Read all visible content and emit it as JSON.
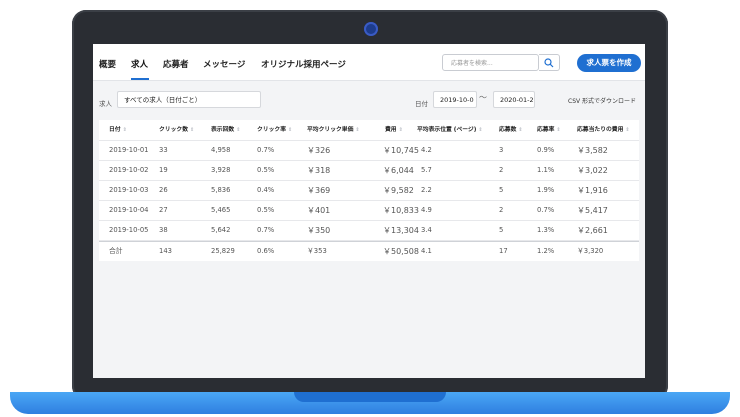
{
  "nav": {
    "tabs": [
      {
        "label": "概要"
      },
      {
        "label": "求人"
      },
      {
        "label": "応募者"
      },
      {
        "label": "メッセージ"
      },
      {
        "label": "オリジナル採用ページ"
      }
    ],
    "active_tab": "求人",
    "search_placeholder": "応募者を検索...",
    "create_button": "求人票を作成"
  },
  "filters": {
    "job_label": "求人",
    "job_value": "すべての求人（日付ごと）",
    "date_label": "日付",
    "date_from": "2019-10-0",
    "date_to": "2020-01-2",
    "date_separator": "〜",
    "csv_link": "CSV 形式でダウンロード"
  },
  "table": {
    "headers": [
      "日付",
      "クリック数",
      "表示回数",
      "クリック率",
      "平均クリック単価",
      "費用",
      "平均表示位置 (ページ)",
      "応募数",
      "応募率",
      "応募当たりの費用"
    ],
    "rows": [
      [
        "2019-10-01",
        "33",
        "4,958",
        "0.7%",
        "￥326",
        "￥10,745",
        "4.2",
        "3",
        "0.9%",
        "￥3,582"
      ],
      [
        "2019-10-02",
        "19",
        "3,928",
        "0.5%",
        "￥318",
        "￥6,044",
        "5.7",
        "2",
        "1.1%",
        "￥3,022"
      ],
      [
        "2019-10-03",
        "26",
        "5,836",
        "0.4%",
        "￥369",
        "￥9,582",
        "2.2",
        "5",
        "1.9%",
        "￥1,916"
      ],
      [
        "2019-10-04",
        "27",
        "5,465",
        "0.5%",
        "￥401",
        "￥10,833",
        "4.9",
        "2",
        "0.7%",
        "￥5,417"
      ],
      [
        "2019-10-05",
        "38",
        "5,642",
        "0.7%",
        "￥350",
        "￥13,304",
        "3.4",
        "5",
        "1.3%",
        "￥2,661"
      ]
    ],
    "total": [
      "合計",
      "143",
      "25,829",
      "0.6%",
      "￥353",
      "￥50,508",
      "4.1",
      "17",
      "1.2%",
      "￥3,320"
    ]
  },
  "colors": {
    "accent": "#1f6fd1",
    "frame": "#2a2d33",
    "base": "#3b8ff0"
  }
}
